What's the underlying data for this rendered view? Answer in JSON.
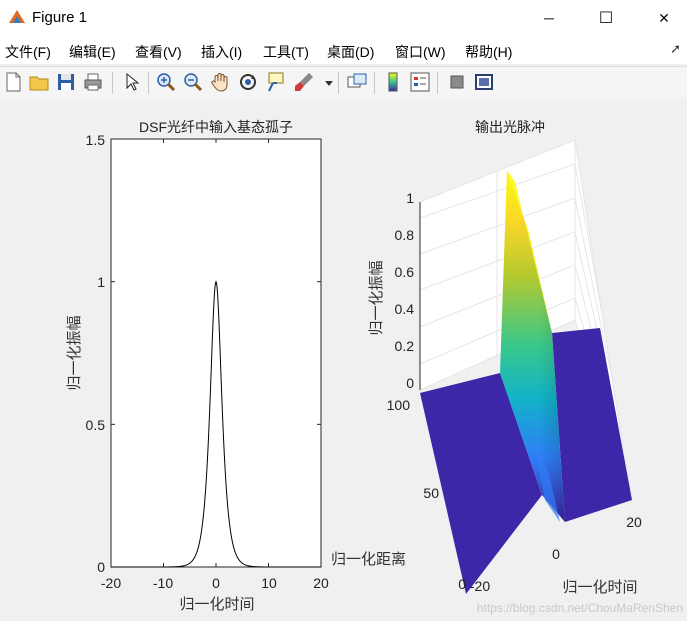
{
  "window": {
    "title": "Figure 1",
    "minimize_label": "─",
    "maximize_label": "☐",
    "close_label": "✕"
  },
  "menu": {
    "items": [
      "文件(F)",
      "编辑(E)",
      "查看(V)",
      "插入(I)",
      "工具(T)",
      "桌面(D)",
      "窗口(W)",
      "帮助(H)"
    ]
  },
  "toolbar": {
    "icons": [
      "new-figure-icon",
      "open-file-icon",
      "save-icon",
      "print-icon",
      "pointer-icon",
      "zoom-in-icon",
      "zoom-out-icon",
      "pan-hand-icon",
      "rotate-3d-icon",
      "data-cursor-icon",
      "brush-icon",
      "brush-dropdown-icon",
      "link-plot-icon",
      "colorbar-icon",
      "legend-icon",
      "hide-plot-tools-icon",
      "show-plot-tools-icon"
    ]
  },
  "watermark": "https://blog.csdn.net/ChouMaRenShen",
  "chart_data": [
    {
      "type": "line",
      "title": "DSF光纤中输入基态孤子",
      "xlabel": "归一化时间",
      "ylabel": "归一化振幅",
      "xlim": [
        -20,
        20
      ],
      "ylim": [
        0,
        1.5
      ],
      "xticks": [
        "-20",
        "-10",
        "0",
        "10",
        "20"
      ],
      "yticks": [
        "0",
        "0.5",
        "1",
        "1.5"
      ],
      "function": "sech",
      "x": [
        -20,
        -10,
        -8,
        -6,
        -5,
        -4,
        -3,
        -2.5,
        -2,
        -1.5,
        -1,
        -0.5,
        0,
        0.5,
        1,
        1.5,
        2,
        2.5,
        3,
        4,
        5,
        6,
        8,
        10,
        20
      ],
      "y": [
        0,
        0.0001,
        0.0007,
        0.005,
        0.013,
        0.037,
        0.099,
        0.163,
        0.266,
        0.425,
        0.648,
        0.887,
        1.0,
        0.887,
        0.648,
        0.425,
        0.266,
        0.163,
        0.099,
        0.037,
        0.013,
        0.005,
        0.0007,
        0.0001,
        0
      ],
      "grid": false
    },
    {
      "type": "surface",
      "title": "输出光脉冲",
      "xlabel": "归一化时间",
      "ylabel": "归一化距离",
      "zlabel": "归一化振幅",
      "xticks": [
        "-20",
        "0",
        "20"
      ],
      "yticks": [
        "0",
        "50",
        "100"
      ],
      "zticks": [
        "0",
        "0.2",
        "0.4",
        "0.6",
        "0.8",
        "1"
      ],
      "xlim": [
        -20,
        20
      ],
      "ylim": [
        0,
        100
      ],
      "zlim": [
        0,
        1
      ],
      "peak_amplitude": 1.0,
      "colormap": [
        "#3e26a8",
        "#2f7ef7",
        "#12b2c9",
        "#38c88c",
        "#b5c92e",
        "#f9d629",
        "#f9fb0e"
      ]
    }
  ]
}
